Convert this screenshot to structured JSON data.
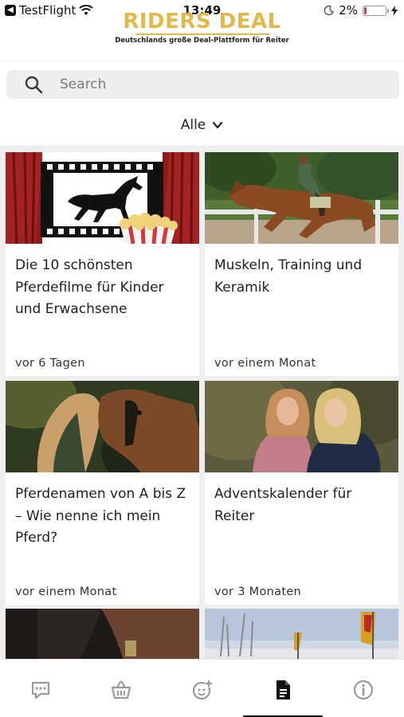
{
  "status_bar": {
    "back_app": "TestFlight",
    "time": "13:49",
    "battery_percent": "2%",
    "battery_level": 0.02
  },
  "brand": {
    "logo_text": "RIDERS DEAL",
    "tagline": "Deutschlands große Deal-Plattform für Reiter",
    "accent_color": "#e2b84a"
  },
  "search": {
    "placeholder": "Search"
  },
  "filter": {
    "label": "Alle"
  },
  "articles": [
    {
      "title": "Die 10 schönsten Pferdefilme für Kinder und Erwachsene",
      "date": "vor 6 Tagen"
    },
    {
      "title": "Muskeln, Training und Keramik",
      "date": "vor einem Monat"
    },
    {
      "title": "Pferdenamen von A bis Z – Wie nenne ich mein Pferd?",
      "date": "vor einem Monat"
    },
    {
      "title": "Adventskalender für Reiter",
      "date": "vor 3 Monaten"
    }
  ],
  "tabs": [
    {
      "icon": "chat-icon",
      "active": false
    },
    {
      "icon": "basket-icon",
      "active": false
    },
    {
      "icon": "face-plus-icon",
      "active": false
    },
    {
      "icon": "document-icon",
      "active": true
    },
    {
      "icon": "info-icon",
      "active": false
    }
  ]
}
